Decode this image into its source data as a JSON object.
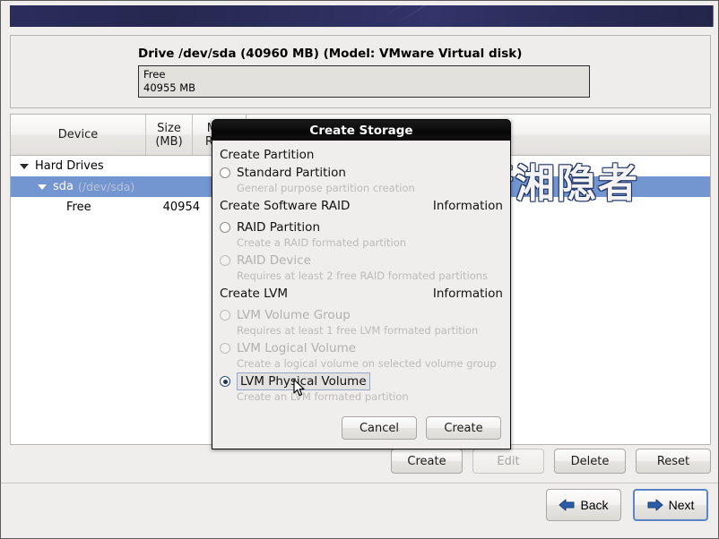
{
  "window": {
    "banner_alt": "anaconda-header-banner"
  },
  "drive": {
    "title": "Drive /dev/sda (40960 MB) (Model: VMware Virtual disk)",
    "bar": {
      "label": "Free",
      "size": "40955 MB"
    }
  },
  "table": {
    "headers": {
      "device": "Device",
      "size_line1": "Size",
      "size_line2": "(MB)",
      "mount_line1": "Mou",
      "mount_line2": "RAID"
    },
    "rows": [
      {
        "indent": 0,
        "expander": "triangle-down",
        "device": "Hard Drives",
        "path": "",
        "size": "",
        "selected": false
      },
      {
        "indent": 1,
        "expander": "triangle-down",
        "device": "sda",
        "path": "(/dev/sda)",
        "size": "",
        "selected": true
      },
      {
        "indent": 2,
        "expander": "",
        "device": "Free",
        "path": "",
        "size": "40954",
        "selected": false
      }
    ]
  },
  "watermark": {
    "text": "潇湘隐者"
  },
  "actions": {
    "create": "Create",
    "edit": "Edit",
    "delete": "Delete",
    "reset": "Reset"
  },
  "nav": {
    "back": "Back",
    "next": "Next"
  },
  "dialog": {
    "title": "Create Storage",
    "groups": [
      {
        "heading": "Create Partition",
        "information": "",
        "options": [
          {
            "label": "Standard Partition",
            "hint": "General purpose partition creation",
            "selected": false,
            "disabled": false,
            "focused": false
          }
        ]
      },
      {
        "heading": "Create Software RAID",
        "information": "Information",
        "options": [
          {
            "label": "RAID Partition",
            "hint": "Create a RAID formated partition",
            "selected": false,
            "disabled": false,
            "focused": false
          },
          {
            "label": "RAID Device",
            "hint": "Requires at least 2 free RAID formated partitions",
            "selected": false,
            "disabled": true,
            "focused": false
          }
        ]
      },
      {
        "heading": "Create LVM",
        "information": "Information",
        "options": [
          {
            "label": "LVM Volume Group",
            "hint": "Requires at least 1 free LVM formated partition",
            "selected": false,
            "disabled": true,
            "focused": false
          },
          {
            "label": "LVM Logical Volume",
            "hint": "Create a logical volume on selected volume group",
            "selected": false,
            "disabled": true,
            "focused": false
          },
          {
            "label": "LVM Physical Volume",
            "hint": "Create an LVM formated partition",
            "selected": true,
            "disabled": false,
            "focused": true
          }
        ]
      }
    ],
    "buttons": {
      "cancel": "Cancel",
      "create": "Create"
    }
  },
  "colors": {
    "banner": "#2a2c5c",
    "selection": "#7396d0",
    "accent": "#2c4a80",
    "focus_outline": "#5b86c6"
  }
}
